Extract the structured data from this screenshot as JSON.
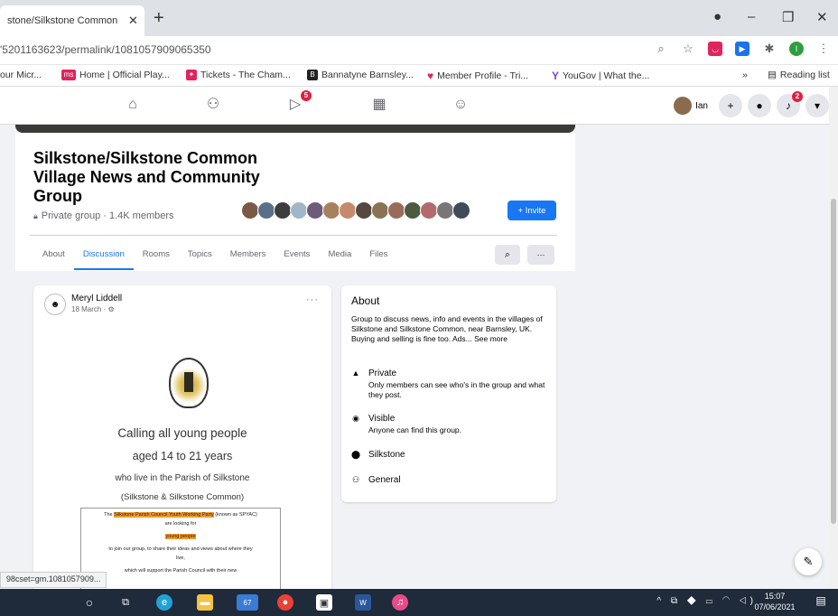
{
  "browser": {
    "tab_title": "stone/Silkstone Common",
    "tab_close": "✕",
    "new_tab": "+",
    "url": "'5201163623/permalink/1081057909065350",
    "window_controls": [
      "–",
      "❐",
      "✕"
    ],
    "bookmarks": [
      {
        "label": "our Micr...",
        "icon": ""
      },
      {
        "label": "Home | Official Play...",
        "icon": "ms",
        "color": "#e0245e"
      },
      {
        "label": "Tickets - The Cham...",
        "icon": "✦",
        "color": "#e0245e"
      },
      {
        "label": "Bannatyne Barnsley...",
        "icon": "B",
        "color": "#222222"
      },
      {
        "label": "Member Profile - Tri...",
        "icon": "♥",
        "color": "#e0245e"
      },
      {
        "label": "YouGov | What the...",
        "icon": "Y",
        "color": "#7b3fe4"
      }
    ],
    "bookmarks_more": "»",
    "reading_list": "Reading list"
  },
  "fbnav": {
    "notif_count": "5",
    "profile_name": "Ian",
    "bell_count": "2"
  },
  "group": {
    "title": "Silkstone/Silkstone Common Village News and Community Group",
    "meta": "Private group · 1.4K members",
    "invite_label": "+ Invite",
    "tabs": [
      "About",
      "Discussion",
      "Rooms",
      "Topics",
      "Members",
      "Events",
      "Media",
      "Files"
    ],
    "more_label": "···"
  },
  "post": {
    "author": "Meryl Liddell",
    "date": "18 March · ⚙",
    "more": "···",
    "line1": "Calling all young people",
    "line2": "aged 14 to 21 years",
    "line3": "who live in the Parish of Silkstone",
    "line4": "(Silkstone & Silkstone Common)",
    "doc": {
      "l1_pre": "The",
      "l1_hl": "Silkstone Parish Council Youth Working Party",
      "l1_post": "(known as SPYAC)",
      "l2": "are looking for",
      "l3_hl": "young people",
      "l4": "to join our group, to share their ideas and views about where they",
      "l5": "live,",
      "l6": "which will support the Parish Council with their new"
    }
  },
  "about": {
    "title": "About",
    "desc": "Group to discuss news, info and events in the villages of Silkstone and Silkstone Common, near Barnsley, UK. Buying and selling is fine too. Ads... See more",
    "private_label": "Private",
    "private_sub": "Only members can see who's in the group and what they post.",
    "visible_label": "Visible",
    "visible_sub": "Anyone can find this group.",
    "location": "Silkstone",
    "category": "General"
  },
  "status_url": "98cset=gm.1081057909...",
  "taskbar": {
    "time": "15:07",
    "date": "07/06/2021",
    "mail_count": "67"
  },
  "colors": {
    "fb_blue": "#1877f2",
    "highlight": "#f39a2b"
  }
}
